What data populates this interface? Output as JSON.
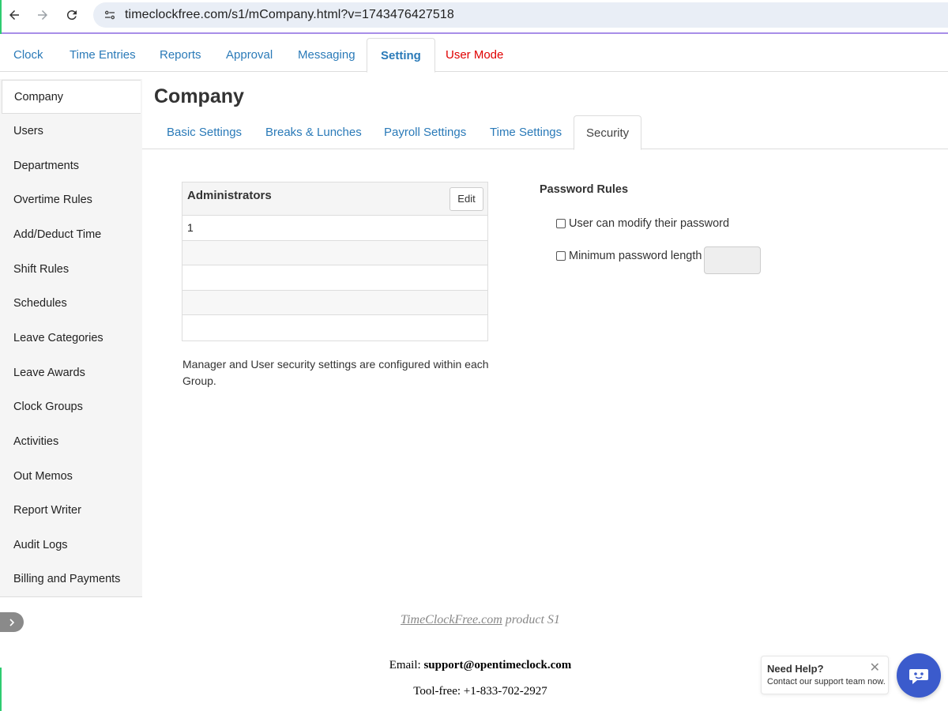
{
  "browser": {
    "url": "timeclockfree.com/s1/mCompany.html?v=1743476427518"
  },
  "top_nav": {
    "tabs": [
      {
        "label": "Clock"
      },
      {
        "label": "Time Entries"
      },
      {
        "label": "Reports"
      },
      {
        "label": "Approval"
      },
      {
        "label": "Messaging"
      },
      {
        "label": "Setting"
      },
      {
        "label": "User Mode"
      }
    ],
    "active": "Setting"
  },
  "sidebar": {
    "items": [
      {
        "label": "Company"
      },
      {
        "label": "Users"
      },
      {
        "label": "Departments"
      },
      {
        "label": "Overtime Rules"
      },
      {
        "label": "Add/Deduct Time"
      },
      {
        "label": "Shift Rules"
      },
      {
        "label": "Schedules"
      },
      {
        "label": "Leave Categories"
      },
      {
        "label": "Leave Awards"
      },
      {
        "label": "Clock Groups"
      },
      {
        "label": "Activities"
      },
      {
        "label": "Out Memos"
      },
      {
        "label": "Report Writer"
      },
      {
        "label": "Audit Logs"
      },
      {
        "label": "Billing and Payments"
      }
    ],
    "active": "Company"
  },
  "main": {
    "title": "Company",
    "tabs": [
      {
        "label": "Basic Settings"
      },
      {
        "label": "Breaks & Lunches"
      },
      {
        "label": "Payroll Settings"
      },
      {
        "label": "Time Settings"
      },
      {
        "label": "Security"
      }
    ],
    "active_tab": "Security"
  },
  "administrators": {
    "title": "Administrators",
    "edit_label": "Edit",
    "rows": [
      "1",
      "",
      "",
      "",
      ""
    ]
  },
  "note": "Manager and User security settings are configured within each Group.",
  "password_rules": {
    "title": "Password Rules",
    "modify_label": "User can modify their password",
    "modify_checked": false,
    "min_length_label": "Minimum password length",
    "min_length_checked": false,
    "min_length_value": ""
  },
  "footer": {
    "product_link": "TimeClockFree.com",
    "product_suffix": "product S1",
    "email_label": "Email:",
    "email": "support@opentimeclock.com",
    "phone_label": "Tool-free:",
    "phone": "+1-833-702-2927"
  },
  "help_widget": {
    "title": "Need Help?",
    "text": "Contact our support team now.",
    "close": "✕"
  },
  "colors": {
    "link": "#2a7ab8",
    "user_mode": "#e00000",
    "chat_button": "#3b5bcc"
  }
}
